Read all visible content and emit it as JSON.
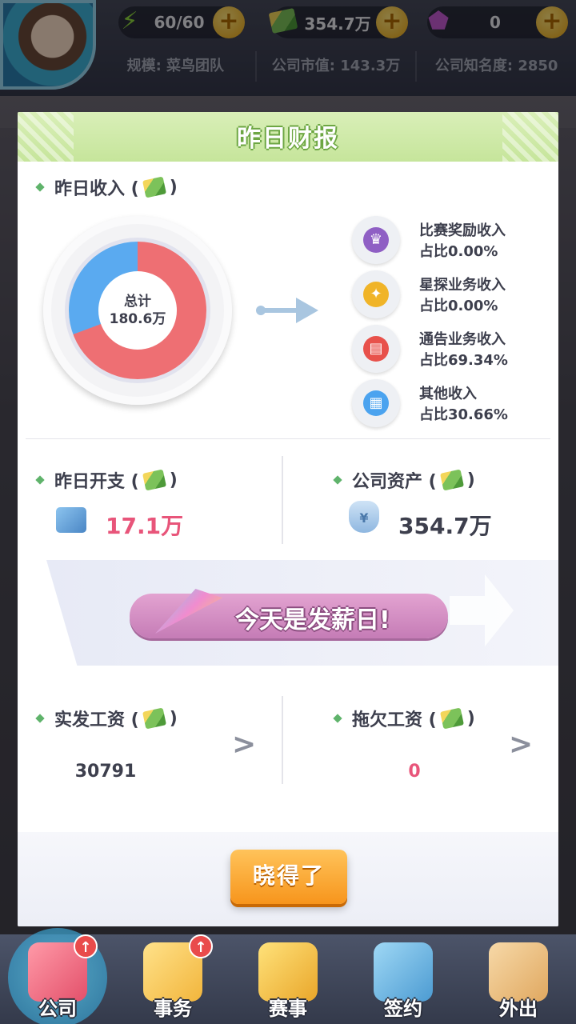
{
  "topbar": {
    "energy": "60/60",
    "cash": "354.7万",
    "gems": "0",
    "scale": "规模: 菜鸟团队",
    "market_value": "公司市值: 143.3万",
    "fame": "公司知名度: 2850"
  },
  "dialog": {
    "title": "昨日财报",
    "income": {
      "label": "昨日收入 (",
      "label_close": ")",
      "total_label": "总计",
      "total_value": "180.6万",
      "items": [
        {
          "name": "比赛奖励收入",
          "share": "占比0.00%",
          "color": "#8f5fc4",
          "icon": "trophy-icon"
        },
        {
          "name": "星探业务收入",
          "share": "占比0.00%",
          "color": "#f0b428",
          "icon": "star-compass-icon"
        },
        {
          "name": "通告业务收入",
          "share": "占比69.34%",
          "color": "#e8514b",
          "icon": "clapperboard-icon"
        },
        {
          "name": "其他收入",
          "share": "占比30.66%",
          "color": "#4ba3ef",
          "icon": "grid-icon"
        }
      ]
    },
    "expense": {
      "label": "昨日开支 (",
      "label_close": ")",
      "value": "17.1万"
    },
    "assets": {
      "label": "公司资产 (",
      "label_close": ")",
      "value": "354.7万"
    },
    "payday": "今天是发薪日!",
    "paid_wages": {
      "label": "实发工资 (",
      "label_close": ")",
      "value": "30791"
    },
    "owed_wages": {
      "label": "拖欠工资 (",
      "label_close": ")",
      "value": "0"
    },
    "ok_button": "晓得了"
  },
  "chart_data": {
    "type": "pie",
    "categories": [
      "比赛奖励收入",
      "星探业务收入",
      "通告业务收入",
      "其他收入"
    ],
    "values": [
      0.0,
      0.0,
      69.34,
      30.66
    ],
    "title": "昨日收入"
  },
  "nav": [
    "公司",
    "事务",
    "赛事",
    "签约",
    "外出"
  ],
  "colors": {
    "accent_green": "#c6e59b",
    "income_red": "#ee6f73",
    "income_blue": "#5aaaf0",
    "expense_pink": "#e8557a",
    "button_orange": "#f7951c"
  }
}
